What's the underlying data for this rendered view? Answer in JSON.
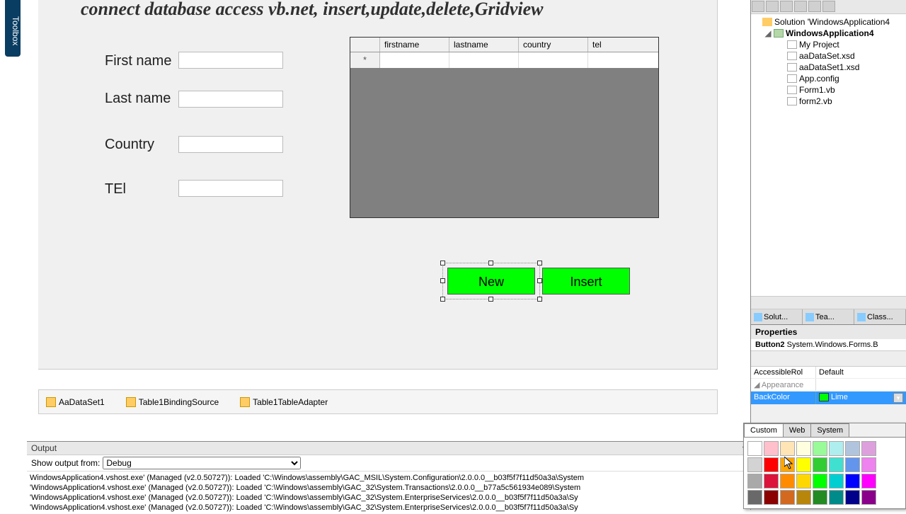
{
  "toolbox": "Toolbox",
  "form": {
    "title": "connect database access vb.net, insert,update,delete,Gridview",
    "labels": {
      "firstname": "First name",
      "lastname": "Last name",
      "country": "Country",
      "tel": "TEl"
    },
    "grid_columns": [
      "firstname",
      "lastname",
      "country",
      "tel"
    ],
    "buttons": {
      "new": "New",
      "insert": "Insert"
    }
  },
  "components": [
    "AaDataSet1",
    "Table1BindingSource",
    "Table1TableAdapter"
  ],
  "output": {
    "title": "Output",
    "show_from_label": "Show output from:",
    "show_from_value": "Debug",
    "lines": [
      "WindowsApplication4.vshost.exe' (Managed (v2.0.50727)): Loaded 'C:\\Windows\\assembly\\GAC_MSIL\\System.Configuration\\2.0.0.0__b03f5f7f11d50a3a\\System",
      "'WindowsApplication4.vshost.exe' (Managed (v2.0.50727)): Loaded 'C:\\Windows\\assembly\\GAC_32\\System.Transactions\\2.0.0.0__b77a5c561934e089\\System",
      "'WindowsApplication4.vshost.exe' (Managed (v2.0.50727)): Loaded 'C:\\Windows\\assembly\\GAC_32\\System.EnterpriseServices\\2.0.0.0__b03f5f7f11d50a3a\\Sy",
      "'WindowsApplication4.vshost.exe' (Managed (v2.0.50727)): Loaded 'C:\\Windows\\assembly\\GAC_32\\System.EnterpriseServices\\2.0.0.0__b03f5f7f11d50a3a\\Sy"
    ]
  },
  "solution": {
    "root": "Solution 'WindowsApplication4",
    "project": "WindowsApplication4",
    "items": [
      "My Project",
      "aaDataSet.xsd",
      "aaDataSet1.xsd",
      "App.config",
      "Form1.vb",
      "form2.vb"
    ],
    "tabs": [
      "Solut...",
      "Tea...",
      "Class..."
    ]
  },
  "properties": {
    "title": "Properties",
    "object_name": "Button2",
    "object_type": "System.Windows.Forms.B",
    "rows": {
      "accessiblerole_k": "AccessibleRol",
      "accessiblerole_v": "Default",
      "appearance": "Appearance",
      "backcolor_k": "BackColor",
      "backcolor_v": "Lime"
    }
  },
  "colorpicker": {
    "tabs": [
      "Custom",
      "Web",
      "System"
    ],
    "colors": [
      "#ffffff",
      "#ffc0cb",
      "#ffe4b5",
      "#ffffe0",
      "#98fb98",
      "#afeeee",
      "#b0c4de",
      "#dda0dd",
      "#d3d3d3",
      "#ff0000",
      "#ffa500",
      "#ffff00",
      "#32cd32",
      "#40e0d0",
      "#6495ed",
      "#ee82ee",
      "#a9a9a9",
      "#dc143c",
      "#ff8c00",
      "#ffd700",
      "#00ff00",
      "#00ced1",
      "#0000ff",
      "#ff00ff",
      "#696969",
      "#8b0000",
      "#d2691e",
      "#b8860b",
      "#228b22",
      "#008b8b",
      "#00008b",
      "#8b008b"
    ]
  }
}
